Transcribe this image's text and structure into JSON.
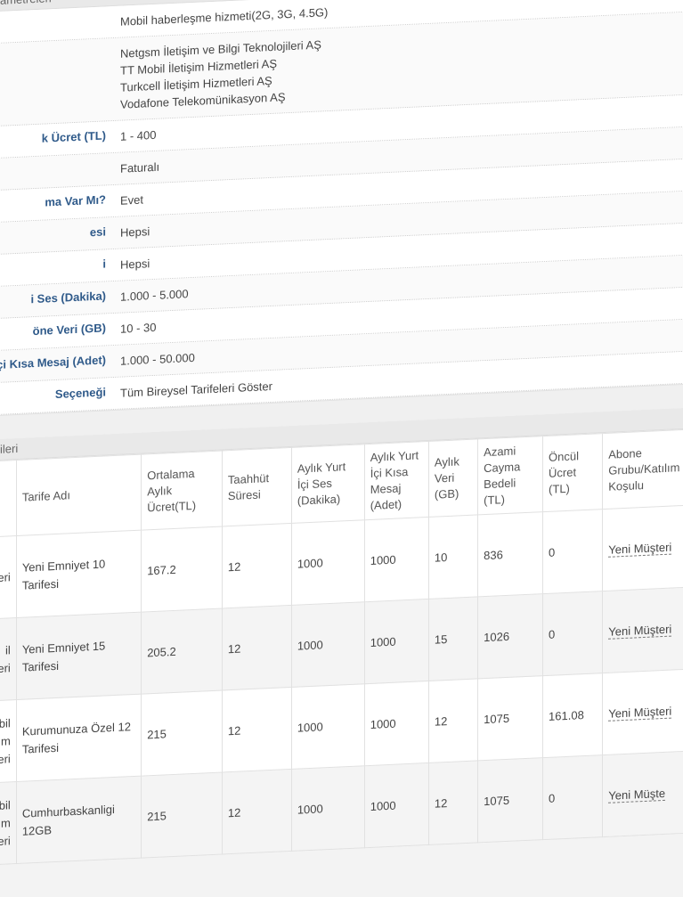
{
  "params_header": "ametreleri",
  "params": [
    {
      "label": "",
      "values": [
        "Mobil haberleşme hizmeti(2G, 3G, 4.5G)"
      ]
    },
    {
      "label": "",
      "values": [
        "Netgsm İletişim ve Bilgi Teknolojileri AŞ",
        "TT Mobil İletişim Hizmetleri AŞ",
        "Turkcell İletişim Hizmetleri AŞ",
        "Vodafone Telekomünikasyon AŞ"
      ]
    },
    {
      "label": "k Ücret (TL)",
      "values": [
        "1 - 400"
      ]
    },
    {
      "label": "",
      "values": [
        "Faturalı"
      ]
    },
    {
      "label": "ma Var Mı?",
      "values": [
        "Evet"
      ]
    },
    {
      "label": "esi",
      "values": [
        "Hepsi"
      ]
    },
    {
      "label": "i",
      "values": [
        "Hepsi"
      ]
    },
    {
      "label": "i Ses (Dakika)",
      "values": [
        "1.000 - 5.000"
      ]
    },
    {
      "label": "öne Veri (GB)",
      "values": [
        "10 - 30"
      ]
    },
    {
      "label": "çi Kısa Mesaj (Adet)",
      "values": [
        "1.000 - 50.000"
      ]
    },
    {
      "label": "Seçeneği",
      "values": [
        "Tüm Bireysel Tarifeleri Göster"
      ]
    }
  ],
  "tariffs_header": "ileri",
  "columns": [
    "",
    "Tarife Adı",
    "Ortalama Aylık Ücret(TL)",
    "Taahhüt Süresi",
    "Aylık Yurt İçi Ses (Dakika)",
    "Aylık Yurt İçi Kısa Mesaj (Adet)",
    "Aylık Veri (GB)",
    "Azami Cayma Bedeli (TL)",
    "Öncül Ücret (TL)",
    "Abone Grubu/Katılım Koşulu"
  ],
  "rows": [
    {
      "operator": "eri",
      "name": "Yeni Emniyet 10 Tarifesi",
      "price": "167.2",
      "term": "12",
      "voice": "1000",
      "sms": "1000",
      "data": "10",
      "penalty": "836",
      "upfront": "0",
      "group": "Yeni Müşteri"
    },
    {
      "operator": "il leri",
      "name": "Yeni Emniyet 15 Tarifesi",
      "price": "205.2",
      "term": "12",
      "voice": "1000",
      "sms": "1000",
      "data": "15",
      "penalty": "1026",
      "upfront": "0",
      "group": "Yeni Müşteri"
    },
    {
      "operator": "bil m tleri",
      "name": "Kurumunuza Özel 12 Tarifesi",
      "price": "215",
      "term": "12",
      "voice": "1000",
      "sms": "1000",
      "data": "12",
      "penalty": "1075",
      "upfront": "161.08",
      "group": "Yeni Müşteri"
    },
    {
      "operator": "obil m etleri",
      "name": "Cumhurbaskanligi 12GB",
      "price": "215",
      "term": "12",
      "voice": "1000",
      "sms": "1000",
      "data": "12",
      "penalty": "1075",
      "upfront": "0",
      "group": "Yeni Müşte"
    }
  ]
}
